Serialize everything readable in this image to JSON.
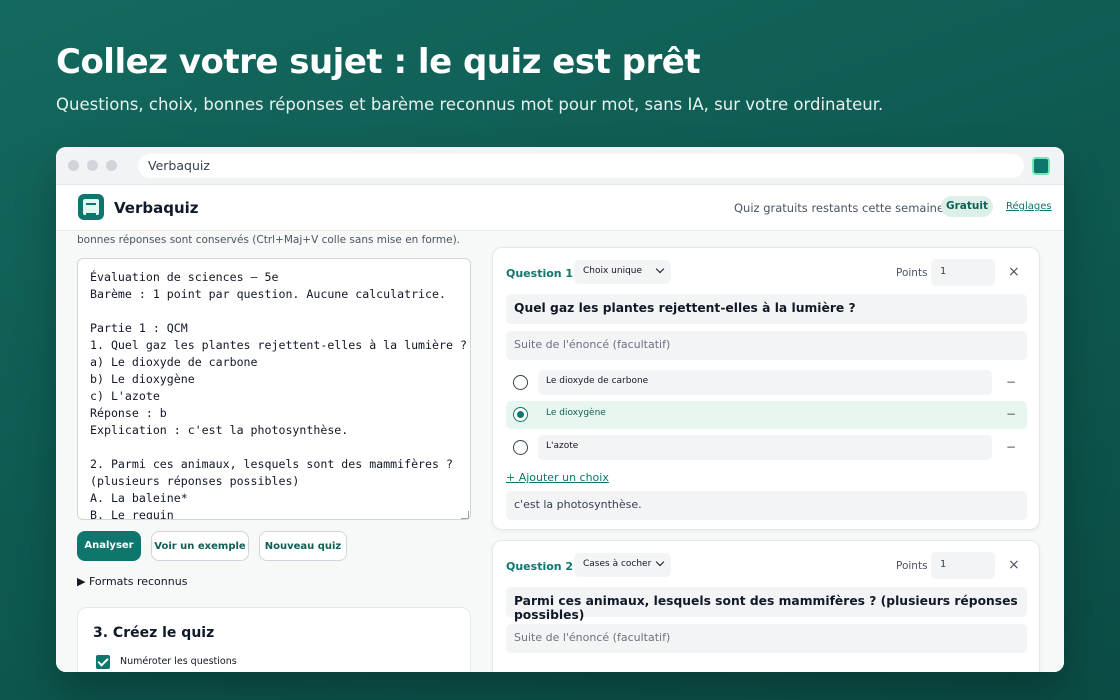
{
  "hero": {
    "title": "Collez votre sujet : le quiz est prêt",
    "subtitle": "Questions, choix, bonnes réponses et barème reconnus mot pour mot, sans IA, sur votre ordinateur."
  },
  "browser": {
    "url": "Verbaquiz"
  },
  "app": {
    "name": "Verbaquiz",
    "quota": "Quiz gratuits restants cette semaine : 3",
    "plan_badge": "Gratuit",
    "settings_link": "Réglages"
  },
  "editor": {
    "hint": "bonnes réponses sont conservés (Ctrl+Maj+V colle sans mise en forme).",
    "text": "Évaluation de sciences — 5e\nBarème : 1 point par question. Aucune calculatrice.\n\nPartie 1 : QCM\n1. Quel gaz les plantes rejettent-elles à la lumière ?\na) Le dioxyde de carbone\nb) Le dioxygène\nc) L'azote\nRéponse : b\nExplication : c'est la photosynthèse.\n\n2. Parmi ces animaux, lesquels sont des mammifères ?\n(plusieurs réponses possibles)\nA. La baleine*\nB. Le requin",
    "analyze_button": "Analyser",
    "example_button": "Voir un exemple",
    "new_button": "Nouveau quiz",
    "formats_toggle": "▶ Formats reconnus"
  },
  "create_section": {
    "title": "3. Créez le quiz",
    "number_questions_label": "Numéroter les questions",
    "number_questions_checked": true
  },
  "questions": [
    {
      "label": "Question 1",
      "type": "Choix unique",
      "points_label": "Points",
      "points": "1",
      "close": "×",
      "title": "Quel gaz les plantes rejettent-elles à la lumière ?",
      "more_placeholder": "Suite de l'énoncé (facultatif)",
      "choices": [
        {
          "text": "Le dioxyde de carbone",
          "correct": false
        },
        {
          "text": "Le dioxygène",
          "correct": true
        },
        {
          "text": "L'azote",
          "correct": false
        }
      ],
      "remove": "−",
      "add_choice": "+ Ajouter un choix",
      "explanation": "c'est la photosynthèse."
    },
    {
      "label": "Question 2",
      "type": "Cases à cocher",
      "points_label": "Points",
      "points": "1",
      "close": "×",
      "title": "Parmi ces animaux, lesquels sont des mammifères ? (plusieurs réponses possibles)",
      "more_placeholder": "Suite de l'énoncé (facultatif)"
    }
  ],
  "colors": {
    "accent": "#0f766e",
    "background": "#0e5b52",
    "correct_bg": "#e7f7ef"
  }
}
